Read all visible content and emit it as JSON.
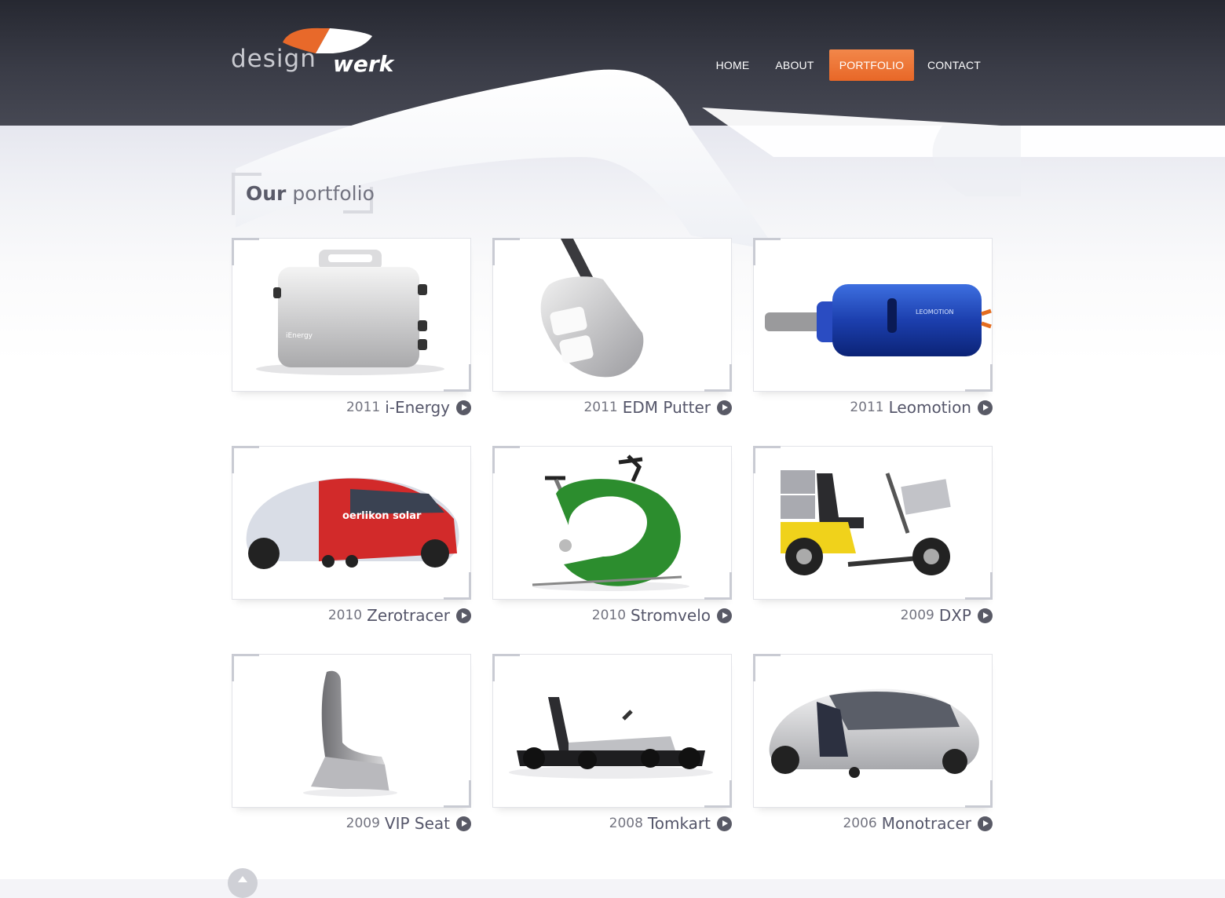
{
  "brand": {
    "name_part1": "design",
    "name_part2": "werk",
    "accent_color": "#e8692a"
  },
  "nav": {
    "items": [
      {
        "label": "HOME",
        "active": false
      },
      {
        "label": "ABOUT",
        "active": false
      },
      {
        "label": "PORTFOLIO",
        "active": true
      },
      {
        "label": "CONTACT",
        "active": false
      }
    ]
  },
  "page": {
    "title_bold": "Our",
    "title_light": "portfolio"
  },
  "portfolio": [
    {
      "year": "2011",
      "name": "i-Energy",
      "image": "battery-box"
    },
    {
      "year": "2011",
      "name": "EDM Putter",
      "image": "golf-putter"
    },
    {
      "year": "2011",
      "name": "Leomotion",
      "image": "blue-motor"
    },
    {
      "year": "2010",
      "name": "Zerotracer",
      "image": "racing-vehicle"
    },
    {
      "year": "2010",
      "name": "Stromvelo",
      "image": "green-exercise-bike"
    },
    {
      "year": "2009",
      "name": "DXP",
      "image": "delivery-scooter"
    },
    {
      "year": "2009",
      "name": "VIP Seat",
      "image": "seat"
    },
    {
      "year": "2008",
      "name": "Tomkart",
      "image": "go-kart"
    },
    {
      "year": "2006",
      "name": "Monotracer",
      "image": "enclosed-motorcycle"
    }
  ],
  "icons": {
    "card_link": "play-circle-icon",
    "back_to_top": "arrow-up-icon"
  }
}
